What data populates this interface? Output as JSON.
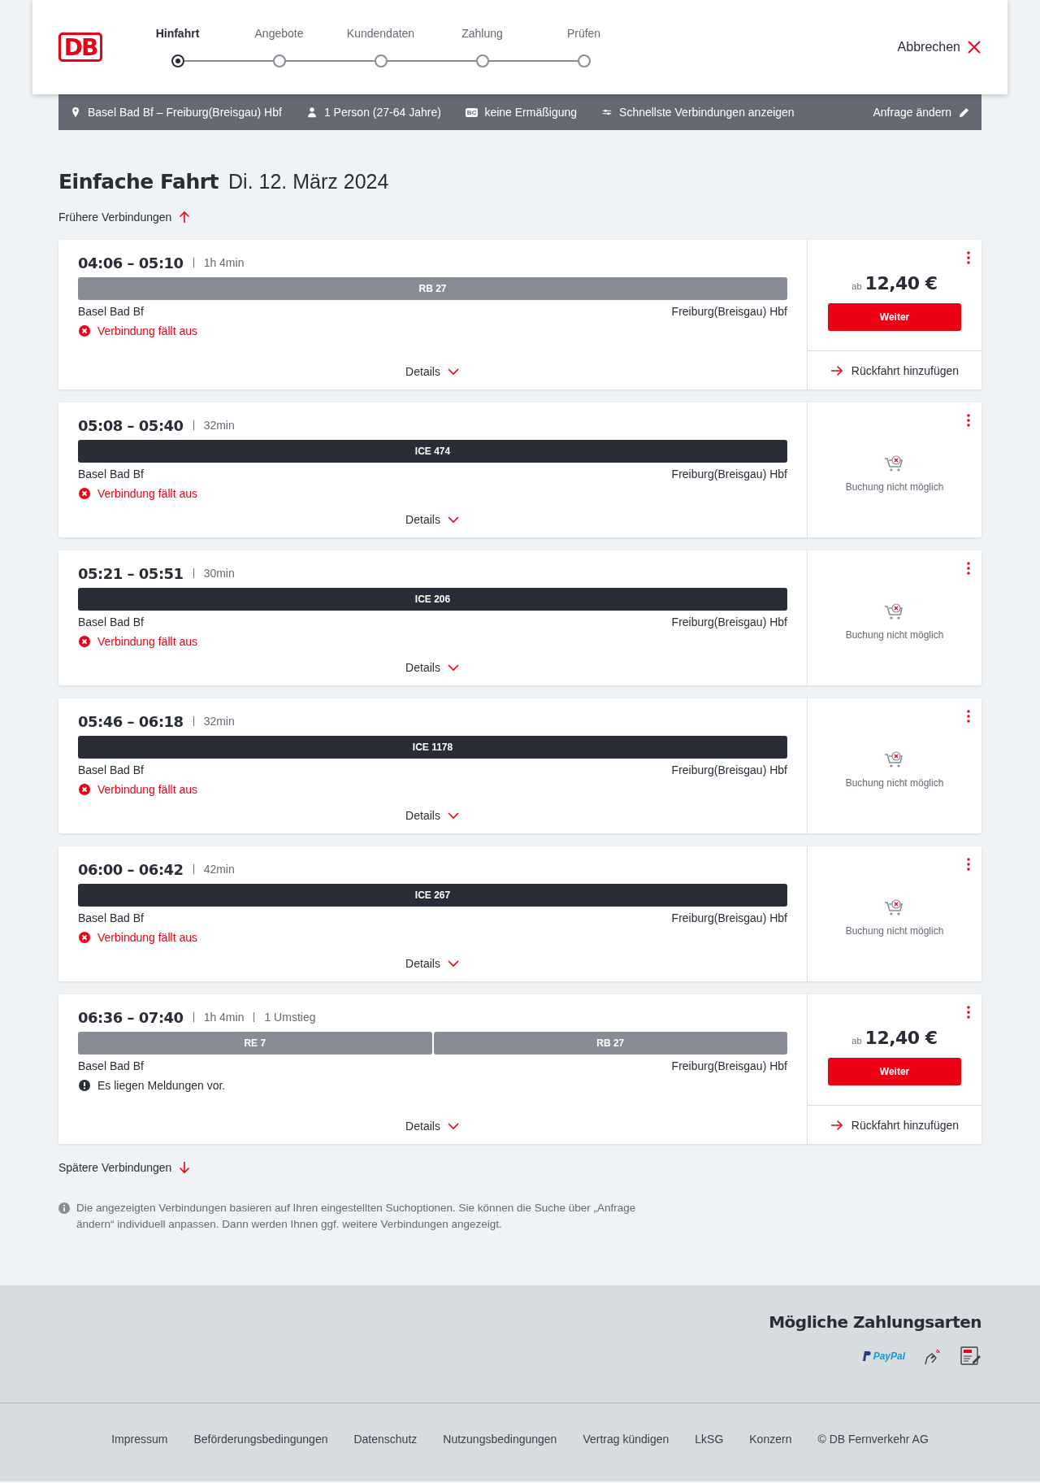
{
  "header": {
    "logo": "DB",
    "steps": [
      {
        "label": "Hinfahrt",
        "selected": true
      },
      {
        "label": "Angebote",
        "selected": false
      },
      {
        "label": "Kundendaten",
        "selected": false
      },
      {
        "label": "Zahlung",
        "selected": false
      },
      {
        "label": "Prüfen",
        "selected": false
      }
    ],
    "cancel": "Abbrechen"
  },
  "summary": {
    "route": "Basel Bad Bf – Freiburg(Breisgau) Hbf",
    "travellers": "1 Person (27-64 Jahre)",
    "discount_badge": "BC",
    "discount": "keine Ermäßigung",
    "option": "Schnellste Verbindungen anzeigen",
    "edit": "Anfrage ändern"
  },
  "title": {
    "trip": "Einfache Fahrt",
    "date": "Di. 12. März 2024"
  },
  "earlier": "Frühere Verbindungen",
  "connections": [
    {
      "time": "04:06 – 05:10",
      "duration": "1h 4min",
      "segments": [
        {
          "train": "RB 27",
          "kind": "regional"
        }
      ],
      "from": "Basel Bad Bf",
      "to": "Freiburg(Breisgau) Hbf",
      "notice": {
        "kind": "cancelled",
        "text": "Verbindung fällt aus"
      },
      "details": "Details",
      "offer": {
        "kind": "price",
        "prefix": "ab",
        "price": "12,40 €",
        "button": "Weiter",
        "return": "Rückfahrt hinzufügen"
      }
    },
    {
      "time": "05:08 – 05:40",
      "duration": "32min",
      "segments": [
        {
          "train": "ICE 474",
          "kind": "longdistance"
        }
      ],
      "from": "Basel Bad Bf",
      "to": "Freiburg(Breisgau) Hbf",
      "notice": {
        "kind": "cancelled",
        "text": "Verbindung fällt aus"
      },
      "details": "Details",
      "offer": {
        "kind": "unavailable",
        "text": "Buchung nicht möglich"
      }
    },
    {
      "time": "05:21 – 05:51",
      "duration": "30min",
      "segments": [
        {
          "train": "ICE 206",
          "kind": "longdistance"
        }
      ],
      "from": "Basel Bad Bf",
      "to": "Freiburg(Breisgau) Hbf",
      "notice": {
        "kind": "cancelled",
        "text": "Verbindung fällt aus"
      },
      "details": "Details",
      "offer": {
        "kind": "unavailable",
        "text": "Buchung nicht möglich"
      }
    },
    {
      "time": "05:46 – 06:18",
      "duration": "32min",
      "segments": [
        {
          "train": "ICE 1178",
          "kind": "longdistance"
        }
      ],
      "from": "Basel Bad Bf",
      "to": "Freiburg(Breisgau) Hbf",
      "notice": {
        "kind": "cancelled",
        "text": "Verbindung fällt aus"
      },
      "details": "Details",
      "offer": {
        "kind": "unavailable",
        "text": "Buchung nicht möglich"
      }
    },
    {
      "time": "06:00 – 06:42",
      "duration": "42min",
      "segments": [
        {
          "train": "ICE 267",
          "kind": "longdistance"
        }
      ],
      "from": "Basel Bad Bf",
      "to": "Freiburg(Breisgau) Hbf",
      "notice": {
        "kind": "cancelled",
        "text": "Verbindung fällt aus"
      },
      "details": "Details",
      "offer": {
        "kind": "unavailable",
        "text": "Buchung nicht möglich"
      }
    },
    {
      "time": "06:36 – 07:40",
      "duration": "1h 4min",
      "changes": "1 Umstieg",
      "segments": [
        {
          "train": "RE 7",
          "kind": "regional"
        },
        {
          "train": "RB 27",
          "kind": "regional"
        }
      ],
      "from": "Basel Bad Bf",
      "to": "Freiburg(Breisgau) Hbf",
      "notice": {
        "kind": "info",
        "text": "Es liegen Meldungen vor."
      },
      "details": "Details",
      "offer": {
        "kind": "price",
        "prefix": "ab",
        "price": "12,40 €",
        "button": "Weiter",
        "return": "Rückfahrt hinzufügen"
      }
    }
  ],
  "later": "Spätere Verbindungen",
  "note": "Die angezeigten Verbindungen basieren auf Ihren eingestellten Suchoptionen. Sie können die Suche über „Anfrage ändern“ individuell anpassen. Dann werden Ihnen ggf. weitere Verbindungen angezeigt.",
  "payments": {
    "title": "Mögliche Zahlungsarten",
    "methods": [
      {
        "kind": "paypal",
        "label": "PayPal"
      },
      {
        "kind": "contactless"
      },
      {
        "kind": "sepa"
      }
    ]
  },
  "footer_links": [
    "Impressum",
    "Beförderungsbedingungen",
    "Datenschutz",
    "Nutzungsbedingungen",
    "Vertrag kündigen",
    "LkSG",
    "Konzern",
    "© DB Fernverkehr AG"
  ]
}
